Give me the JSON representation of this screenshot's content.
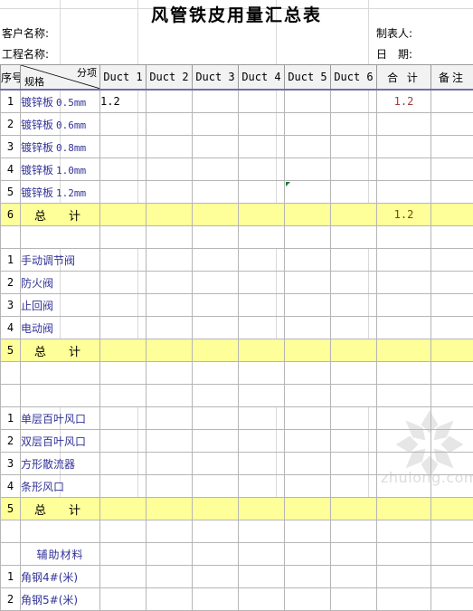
{
  "title": "风管铁皮用量汇总表",
  "meta": {
    "customer_label": "客户名称:",
    "project_label": "工程名称:",
    "preparer_label": "制表人:",
    "date_label": "日　期:"
  },
  "colors": {
    "total_row_fill": "#ffff99",
    "spec_text": "#333399",
    "total_value_text": "#a33b3b",
    "header_fill": "#f2f2f2",
    "header_underline": "#6f6fa8",
    "grid": "#b6b6b6",
    "error_flag": "#1f7a38"
  },
  "table": {
    "corner": {
      "seq_label": "序号",
      "category_label": "分项",
      "spec_label": "规格"
    },
    "columns": [
      "Duct 1",
      "Duct 2",
      "Duct 3",
      "Duct 4",
      "Duct 5",
      "Duct 6"
    ],
    "total_label": "合 计",
    "note_label": "备注",
    "grand_total_label": "总　计",
    "rows": [
      {
        "kind": "data",
        "seq": "1",
        "spec": "镀锌板",
        "thickness": "0.5mm",
        "ducts": [
          "1.2",
          "",
          "",
          "",
          "",
          ""
        ],
        "total": "1.2",
        "note": ""
      },
      {
        "kind": "data",
        "seq": "2",
        "spec": "镀锌板",
        "thickness": "0.6mm",
        "ducts": [
          "",
          "",
          "",
          "",
          "",
          ""
        ],
        "total": "",
        "note": ""
      },
      {
        "kind": "data",
        "seq": "3",
        "spec": "镀锌板",
        "thickness": "0.8mm",
        "ducts": [
          "",
          "",
          "",
          "",
          "",
          ""
        ],
        "total": "",
        "note": ""
      },
      {
        "kind": "data",
        "seq": "4",
        "spec": "镀锌板",
        "thickness": "1.0mm",
        "ducts": [
          "",
          "",
          "",
          "",
          "",
          ""
        ],
        "total": "",
        "note": ""
      },
      {
        "kind": "data",
        "seq": "5",
        "spec": "镀锌板",
        "thickness": "1.2mm",
        "ducts": [
          "",
          "",
          "",
          "",
          "",
          ""
        ],
        "total": "",
        "note": "",
        "error_flag_col": 4
      },
      {
        "kind": "total",
        "seq": "6",
        "spec": "总　计",
        "thickness": "",
        "ducts": [
          "",
          "",
          "",
          "",
          "",
          ""
        ],
        "total": "1.2",
        "note": ""
      },
      {
        "kind": "spacer",
        "seq": "",
        "spec": "",
        "thickness": "",
        "ducts": [
          "",
          "",
          "",
          "",
          "",
          ""
        ],
        "total": "",
        "note": ""
      },
      {
        "kind": "data",
        "seq": "1",
        "spec": "手动调节阀",
        "thickness": "",
        "ducts": [
          "",
          "",
          "",
          "",
          "",
          ""
        ],
        "total": "",
        "note": ""
      },
      {
        "kind": "data",
        "seq": "2",
        "spec": "防火阀",
        "thickness": "",
        "ducts": [
          "",
          "",
          "",
          "",
          "",
          ""
        ],
        "total": "",
        "note": ""
      },
      {
        "kind": "data",
        "seq": "3",
        "spec": "止回阀",
        "thickness": "",
        "ducts": [
          "",
          "",
          "",
          "",
          "",
          ""
        ],
        "total": "",
        "note": ""
      },
      {
        "kind": "data",
        "seq": "4",
        "spec": "电动阀",
        "thickness": "",
        "ducts": [
          "",
          "",
          "",
          "",
          "",
          ""
        ],
        "total": "",
        "note": ""
      },
      {
        "kind": "total",
        "seq": "5",
        "spec": "总　计",
        "thickness": "",
        "ducts": [
          "",
          "",
          "",
          "",
          "",
          ""
        ],
        "total": "",
        "note": ""
      },
      {
        "kind": "spacer",
        "seq": "",
        "spec": "",
        "thickness": "",
        "ducts": [
          "",
          "",
          "",
          "",
          "",
          ""
        ],
        "total": "",
        "note": ""
      },
      {
        "kind": "spacer",
        "seq": "",
        "spec": "",
        "thickness": "",
        "ducts": [
          "",
          "",
          "",
          "",
          "",
          ""
        ],
        "total": "",
        "note": ""
      },
      {
        "kind": "data",
        "seq": "1",
        "spec": "单层百叶风口",
        "thickness": "",
        "ducts": [
          "",
          "",
          "",
          "",
          "",
          ""
        ],
        "total": "",
        "note": ""
      },
      {
        "kind": "data",
        "seq": "2",
        "spec": "双层百叶风口",
        "thickness": "",
        "ducts": [
          "",
          "",
          "",
          "",
          "",
          ""
        ],
        "total": "",
        "note": ""
      },
      {
        "kind": "data",
        "seq": "3",
        "spec": "方形散流器",
        "thickness": "",
        "ducts": [
          "",
          "",
          "",
          "",
          "",
          ""
        ],
        "total": "",
        "note": ""
      },
      {
        "kind": "data",
        "seq": "4",
        "spec": "条形风口",
        "thickness": "",
        "ducts": [
          "",
          "",
          "",
          "",
          "",
          ""
        ],
        "total": "",
        "note": ""
      },
      {
        "kind": "total",
        "seq": "5",
        "spec": "总　计",
        "thickness": "",
        "ducts": [
          "",
          "",
          "",
          "",
          "",
          ""
        ],
        "total": "",
        "note": ""
      },
      {
        "kind": "spacer",
        "seq": "",
        "spec": "",
        "thickness": "",
        "ducts": [
          "",
          "",
          "",
          "",
          "",
          ""
        ],
        "total": "",
        "note": ""
      },
      {
        "kind": "section",
        "seq": "",
        "spec": "辅助材料",
        "thickness": "",
        "ducts": [
          "",
          "",
          "",
          "",
          "",
          ""
        ],
        "total": "",
        "note": ""
      },
      {
        "kind": "data",
        "seq": "1",
        "spec": "角钢4#(米)",
        "thickness": "",
        "ducts": [
          "",
          "",
          "",
          "",
          "",
          ""
        ],
        "total": "",
        "note": ""
      },
      {
        "kind": "data",
        "seq": "2",
        "spec": "角钢5#(米)",
        "thickness": "",
        "ducts": [
          "",
          "",
          "",
          "",
          "",
          ""
        ],
        "total": "",
        "note": ""
      }
    ]
  },
  "watermark": {
    "text": "zhulong.com",
    "icon": "flower-logo-icon"
  }
}
